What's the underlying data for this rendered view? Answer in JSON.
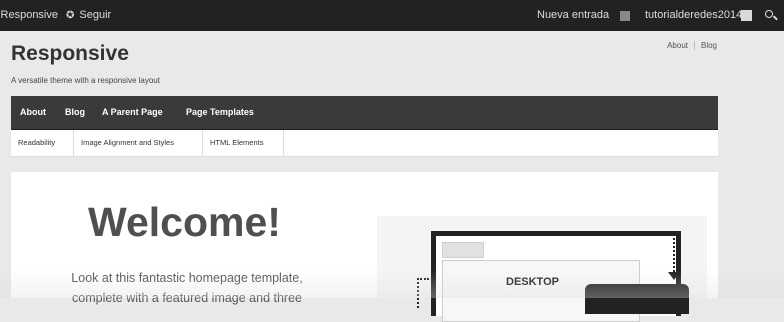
{
  "admin_bar": {
    "site_name": "Responsive",
    "follow_label": "Seguir",
    "follow_icon": "star-icon",
    "new_entry_label": "Nueva entrada",
    "username": "tutorialderedes2014",
    "search_icon": "search-icon"
  },
  "header": {
    "site_title": "Responsive",
    "tagline": "A versatile theme with a responsive layout",
    "top_menu": [
      "About",
      "Blog"
    ]
  },
  "main_menu": {
    "items": [
      "About",
      "Blog",
      "A Parent Page",
      "Page Templates"
    ]
  },
  "sub_menu": {
    "items": [
      "Readability",
      "Image Alignment and Styles",
      "HTML Elements"
    ]
  },
  "content": {
    "welcome_title": "Welcome!",
    "intro_text": "Look at this fantastic homepage template, complete with a featured image and three",
    "feature_label": "DESKTOP"
  },
  "colors": {
    "admin_bar_bg": "#222222",
    "menu_bg": "#3a3a3a",
    "page_bg": "#e9e9e9"
  }
}
